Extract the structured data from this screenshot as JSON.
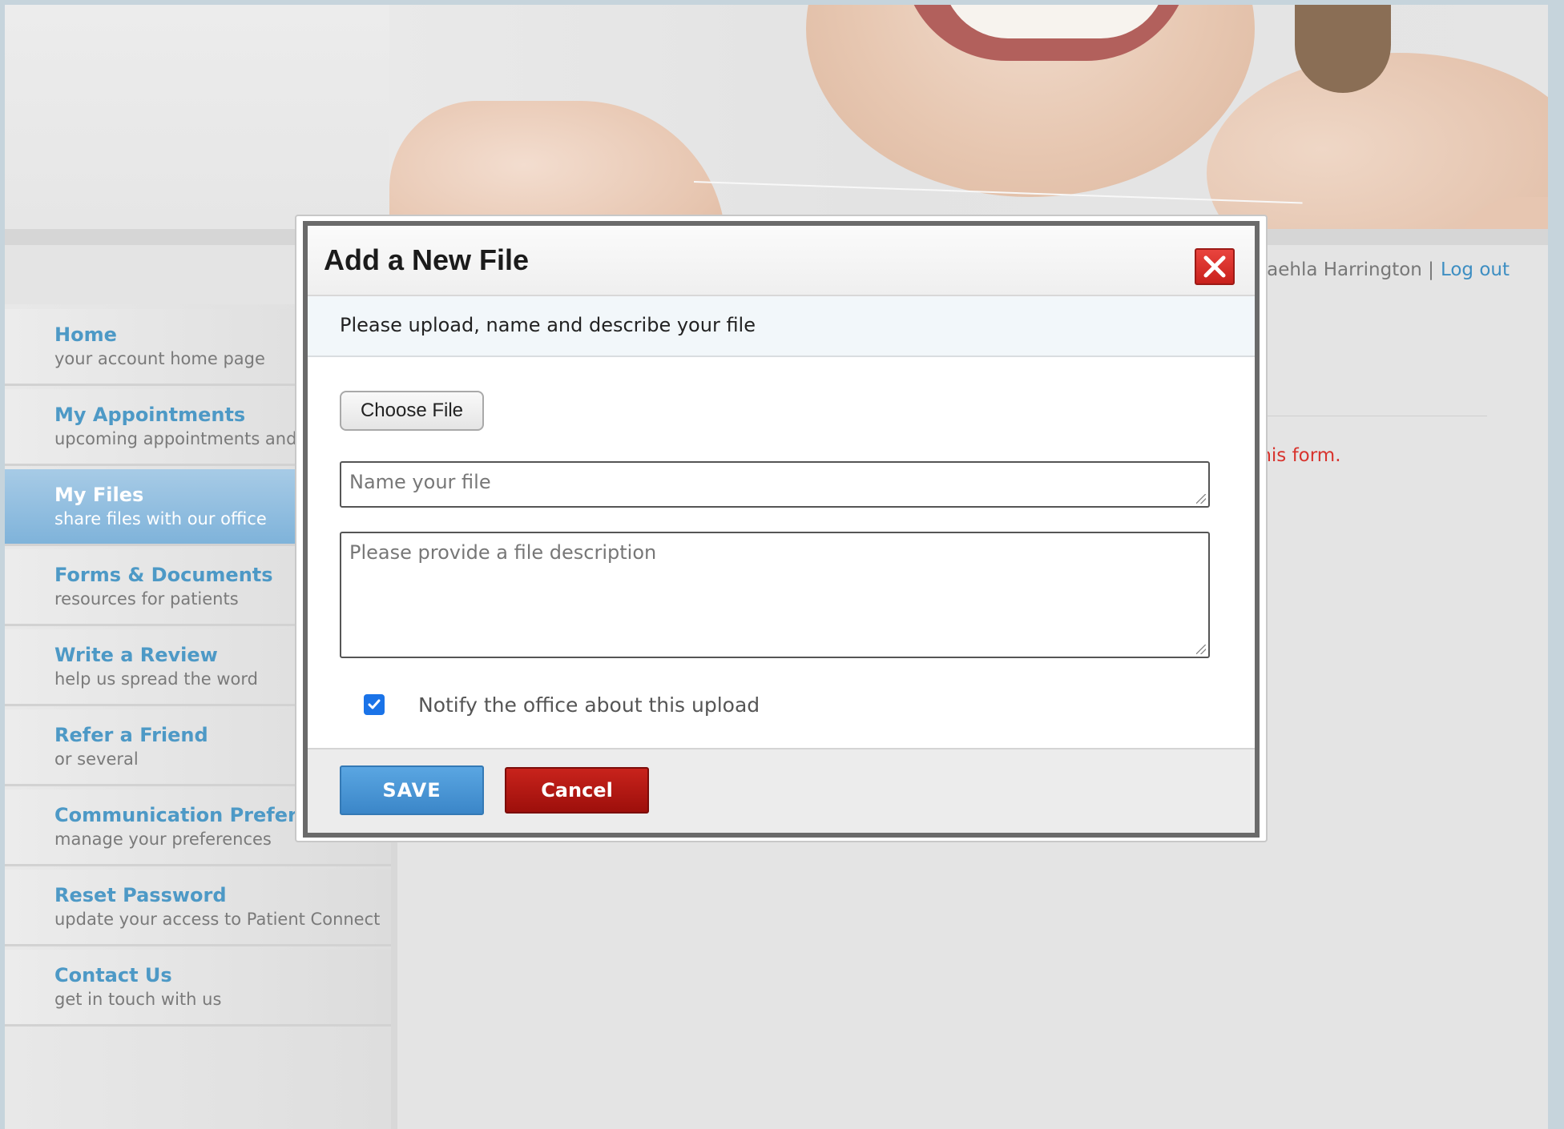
{
  "user_bar": {
    "user_name": "akaehla Harrington |",
    "logout_label": "Log out"
  },
  "main": {
    "error_text": "nit this form."
  },
  "sidebar": {
    "items": [
      {
        "title": "Home",
        "subtitle": "your account home page",
        "active": false
      },
      {
        "title": "My Appointments",
        "subtitle": "upcoming appointments and h",
        "active": false
      },
      {
        "title": "My Files",
        "subtitle": "share files with our office",
        "active": true
      },
      {
        "title": "Forms & Documents",
        "subtitle": "resources for patients",
        "active": false
      },
      {
        "title": "Write a Review",
        "subtitle": "help us spread the word",
        "active": false
      },
      {
        "title": "Refer a Friend",
        "subtitle": "or several",
        "active": false
      },
      {
        "title": "Communication Preferer",
        "subtitle": "manage your preferences",
        "active": false
      },
      {
        "title": "Reset Password",
        "subtitle": "update your access to Patient Connect",
        "active": false
      },
      {
        "title": "Contact Us",
        "subtitle": "get in touch with us",
        "active": false
      }
    ]
  },
  "modal": {
    "title": "Add a New File",
    "close_icon": "close-x-icon",
    "instructions": "Please upload, name and describe your file",
    "choose_file_label": "Choose File",
    "name_placeholder": "Name your file",
    "description_placeholder": "Please provide a file description",
    "notify_label": "Notify the office about this upload",
    "notify_checked": true,
    "save_label": "SAVE",
    "cancel_label": "Cancel"
  },
  "colors": {
    "accent_blue": "#3d8ec2",
    "save_blue": "#4a96d6",
    "cancel_red": "#b0150f",
    "error_red": "#d8332d"
  }
}
